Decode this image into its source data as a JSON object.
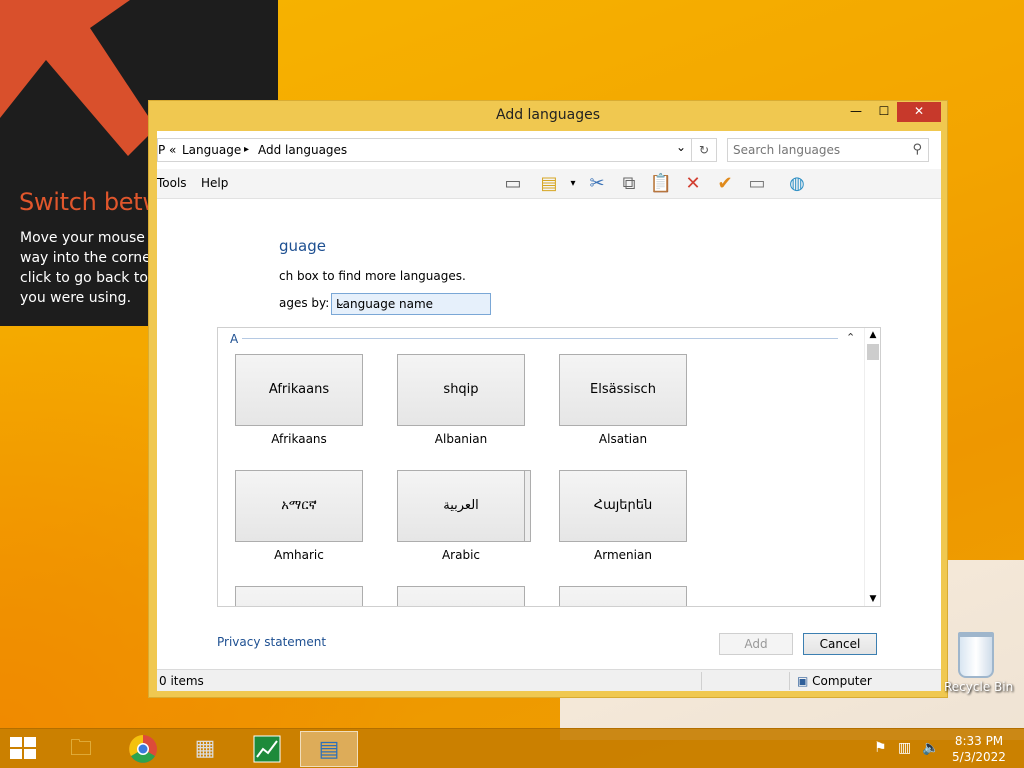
{
  "tip": {
    "title": "Switch between apps",
    "body": "Move your mouse pointer all the way into the corner, and then click to go back to the last app you were using."
  },
  "window": {
    "title": "Add languages",
    "minimize_glyph": "—",
    "maximize_glyph": "☐",
    "close_glyph": "✕"
  },
  "address": {
    "prefix": "P «",
    "crumb1": "Language",
    "crumb_sep": "▸",
    "crumb2": "Add languages",
    "dropdown_glyph": "⌄",
    "refresh_glyph": "↻"
  },
  "search": {
    "placeholder": "Search languages"
  },
  "menu": {
    "tools": "Tools",
    "help": "Help"
  },
  "content": {
    "heading": "guage",
    "hint": "ch box to find more languages.",
    "group_label": "ages by:",
    "group_value": "Language name",
    "section_letter": "A"
  },
  "languages": [
    {
      "tile": "Afrikaans",
      "name": "Afrikaans"
    },
    {
      "tile": "shqip",
      "name": "Albanian"
    },
    {
      "tile": "Elsässisch",
      "name": "Alsatian"
    },
    {
      "tile": "አማርኛ",
      "name": "Amharic"
    },
    {
      "tile": "العربية",
      "name": "Arabic"
    },
    {
      "tile": "Հայերեն",
      "name": "Armenian"
    }
  ],
  "footer": {
    "privacy": "Privacy statement",
    "add": "Add",
    "cancel": "Cancel"
  },
  "status": {
    "items": "0 items",
    "location": "Computer"
  },
  "desktop": {
    "recycle_bin": "Recycle Bin"
  },
  "clock": {
    "time": "8:33 PM",
    "date": "5/3/2022"
  }
}
